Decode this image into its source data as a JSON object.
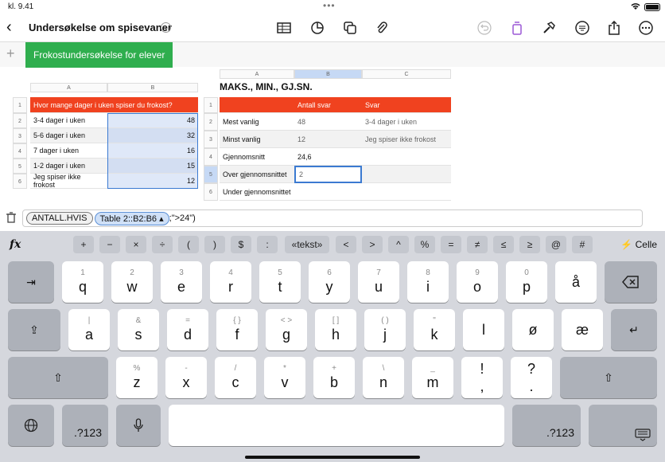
{
  "status": {
    "time": "kl. 9.41",
    "dots": "•••"
  },
  "toolbar": {
    "title": "Undersøkelse om spisevaner"
  },
  "sheet_tab": "Frokostundersøkelse for elever",
  "table1": {
    "columns": [
      "A",
      "B"
    ],
    "rows": [
      {
        "num": "1",
        "a": "Hvor mange dager i uken spiser du frokost?",
        "b": ""
      },
      {
        "num": "2",
        "a": "3-4 dager i uken",
        "b": "48"
      },
      {
        "num": "3",
        "a": "5-6 dager i uken",
        "b": "32"
      },
      {
        "num": "4",
        "a": "7 dager i uken",
        "b": "16"
      },
      {
        "num": "5",
        "a": "1-2 dager i uken",
        "b": "15"
      },
      {
        "num": "6",
        "a": "Jeg spiser ikke frokost",
        "b": "12"
      }
    ]
  },
  "table2": {
    "title": "MAKS., MIN., GJ.SN.",
    "columns": [
      "A",
      "B",
      "C"
    ],
    "header": {
      "b": "Antall svar",
      "c": "Svar"
    },
    "rows": [
      {
        "num": "2",
        "a": "Mest vanlig",
        "b": "48",
        "c": "3-4 dager i uken"
      },
      {
        "num": "3",
        "a": "Minst vanlig",
        "b": "12",
        "c": "Jeg spiser ikke frokost"
      },
      {
        "num": "4",
        "a": "Gjennomsnitt",
        "b": "24,6",
        "c": ""
      },
      {
        "num": "5",
        "a": "Over gjennomsnittet",
        "b": "2",
        "c": ""
      },
      {
        "num": "6",
        "a": "Under gjennomsnittet",
        "b": "",
        "c": ""
      }
    ]
  },
  "formula": {
    "func": "ANTALL.HVIS",
    "ref": "Table 2::B2:B6 ▴",
    "rest": ";\">24\")"
  },
  "fxkeys": [
    "+",
    "−",
    "×",
    "÷",
    "(",
    ")",
    "$",
    ":",
    "«tekst»",
    "<",
    ">",
    "^",
    "%",
    "=",
    "≠",
    "≤",
    "≥",
    "@",
    "#"
  ],
  "celle_label": "Celle",
  "keys": {
    "row1": [
      [
        "1",
        "q"
      ],
      [
        "2",
        "w"
      ],
      [
        "3",
        "e"
      ],
      [
        "4",
        "r"
      ],
      [
        "5",
        "t"
      ],
      [
        "6",
        "y"
      ],
      [
        "7",
        "u"
      ],
      [
        "8",
        "i"
      ],
      [
        "9",
        "o"
      ],
      [
        "0",
        "p"
      ],
      [
        "",
        "å"
      ]
    ],
    "row2": [
      [
        "|",
        "a"
      ],
      [
        "&",
        "s"
      ],
      [
        "=",
        "d"
      ],
      [
        "{ }",
        "f"
      ],
      [
        "< >",
        "g"
      ],
      [
        "[ ]",
        "h"
      ],
      [
        "( )",
        "j"
      ],
      [
        "\"",
        "k"
      ],
      [
        "",
        "l"
      ],
      [
        "",
        "ø"
      ],
      [
        "",
        "æ"
      ]
    ],
    "row3": [
      [
        "%",
        "z"
      ],
      [
        "-",
        "x"
      ],
      [
        "/",
        "c"
      ],
      [
        "*",
        "v"
      ],
      [
        "+",
        "b"
      ],
      [
        "\\",
        "n"
      ],
      [
        "_",
        "m"
      ],
      [
        "!",
        ","
      ],
      [
        "?",
        "."
      ]
    ],
    "num_label": ".?123"
  },
  "colors": {
    "header_red": "#f0421f",
    "tab_green": "#2fae4e",
    "selection_blue": "#3b7ad1"
  }
}
